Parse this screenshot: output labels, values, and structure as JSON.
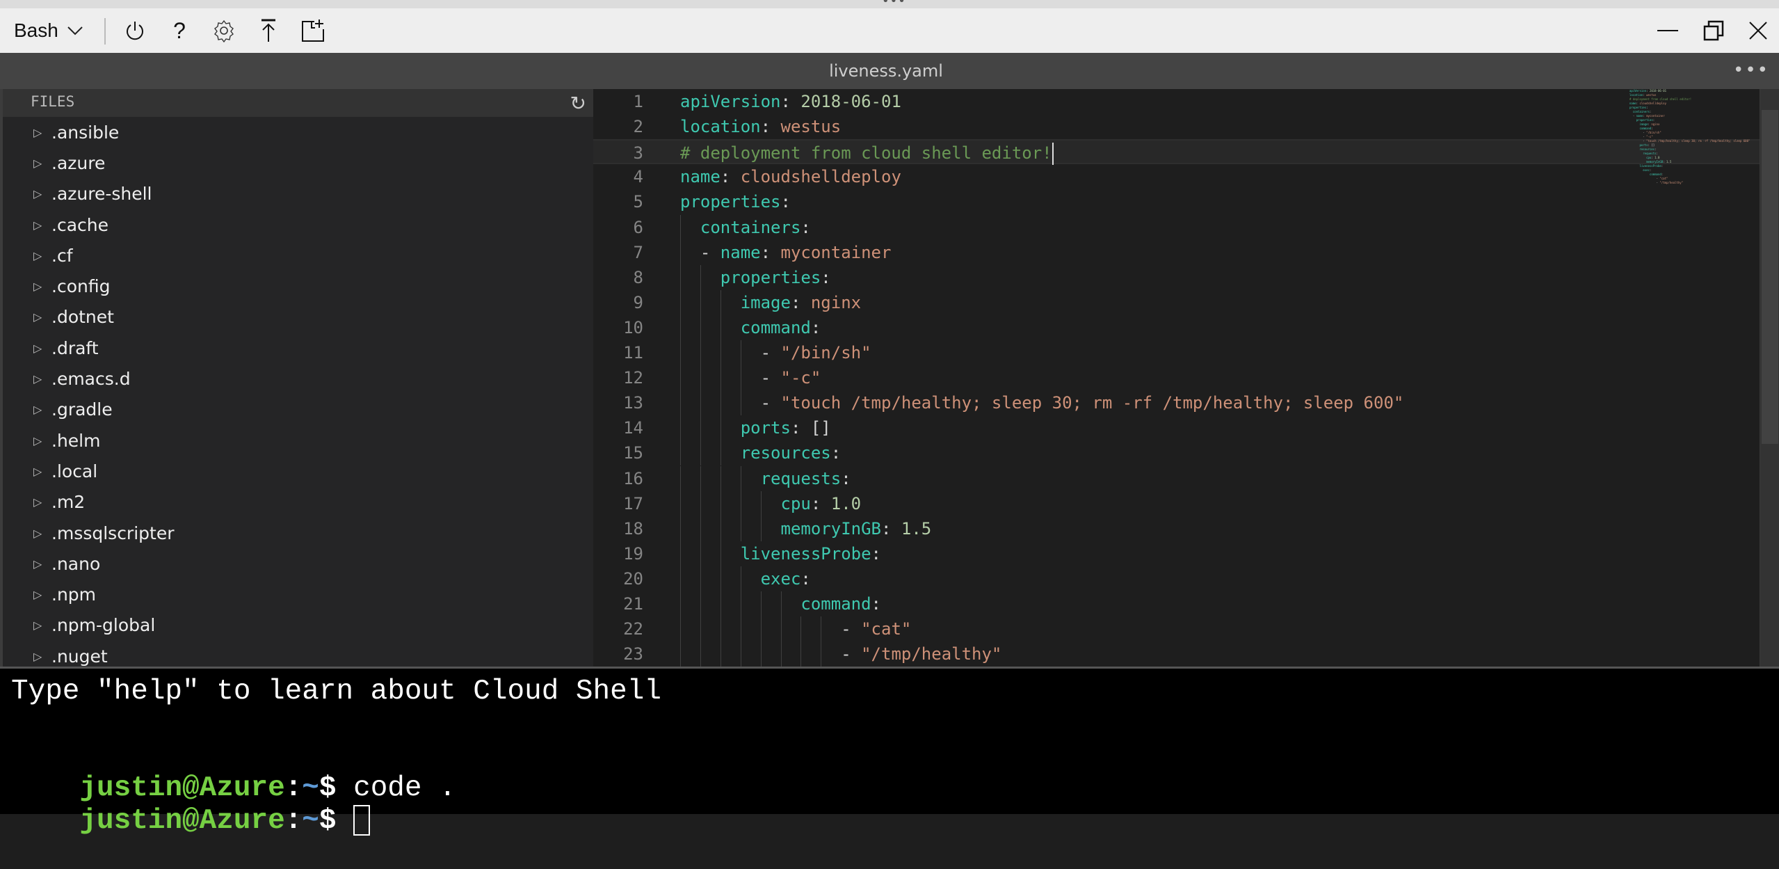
{
  "toolbar": {
    "shell_selector": "Bash",
    "icons": [
      "power-icon",
      "help-icon",
      "gear-icon",
      "upload-icon",
      "new-file-icon"
    ],
    "window_controls": [
      "minimize-icon",
      "restore-icon",
      "close-icon"
    ]
  },
  "editor_tab": {
    "title": "liveness.yaml",
    "more_label": "•••"
  },
  "files": {
    "header": "FILES",
    "items": [
      ".ansible",
      ".azure",
      ".azure-shell",
      ".cache",
      ".cf",
      ".config",
      ".dotnet",
      ".draft",
      ".emacs.d",
      ".gradle",
      ".helm",
      ".local",
      ".m2",
      ".mssqlscripter",
      ".nano",
      ".npm",
      ".npm-global",
      ".nuget"
    ]
  },
  "editor": {
    "cursor_line": 3,
    "lines": [
      [
        [
          "k",
          "apiVersion"
        ],
        [
          "p",
          ": "
        ],
        [
          "n",
          "2018-06-01"
        ]
      ],
      [
        [
          "k",
          "location"
        ],
        [
          "p",
          ": "
        ],
        [
          "s",
          "westus"
        ]
      ],
      [
        [
          "c",
          "# deployment from cloud shell editor!"
        ]
      ],
      [
        [
          "k",
          "name"
        ],
        [
          "p",
          ": "
        ],
        [
          "s",
          "cloudshelldeploy"
        ]
      ],
      [
        [
          "k",
          "properties"
        ],
        [
          "p",
          ":"
        ]
      ],
      [
        [
          "p",
          "  "
        ],
        [
          "k",
          "containers"
        ],
        [
          "p",
          ":"
        ]
      ],
      [
        [
          "p",
          "  - "
        ],
        [
          "k",
          "name"
        ],
        [
          "p",
          ": "
        ],
        [
          "s",
          "mycontainer"
        ]
      ],
      [
        [
          "p",
          "    "
        ],
        [
          "k",
          "properties"
        ],
        [
          "p",
          ":"
        ]
      ],
      [
        [
          "p",
          "      "
        ],
        [
          "k",
          "image"
        ],
        [
          "p",
          ": "
        ],
        [
          "s",
          "nginx"
        ]
      ],
      [
        [
          "p",
          "      "
        ],
        [
          "k",
          "command"
        ],
        [
          "p",
          ":"
        ]
      ],
      [
        [
          "p",
          "        - "
        ],
        [
          "s",
          "\"/bin/sh\""
        ]
      ],
      [
        [
          "p",
          "        - "
        ],
        [
          "s",
          "\"-c\""
        ]
      ],
      [
        [
          "p",
          "        - "
        ],
        [
          "s",
          "\"touch /tmp/healthy; sleep 30; rm -rf /tmp/healthy; sleep 600\""
        ]
      ],
      [
        [
          "p",
          "      "
        ],
        [
          "k",
          "ports"
        ],
        [
          "p",
          ": []"
        ]
      ],
      [
        [
          "p",
          "      "
        ],
        [
          "k",
          "resources"
        ],
        [
          "p",
          ":"
        ]
      ],
      [
        [
          "p",
          "        "
        ],
        [
          "k",
          "requests"
        ],
        [
          "p",
          ":"
        ]
      ],
      [
        [
          "p",
          "          "
        ],
        [
          "k",
          "cpu"
        ],
        [
          "p",
          ": "
        ],
        [
          "n",
          "1.0"
        ]
      ],
      [
        [
          "p",
          "          "
        ],
        [
          "k",
          "memoryInGB"
        ],
        [
          "p",
          ": "
        ],
        [
          "n",
          "1.5"
        ]
      ],
      [
        [
          "p",
          "      "
        ],
        [
          "k",
          "livenessProbe"
        ],
        [
          "p",
          ":"
        ]
      ],
      [
        [
          "p",
          "        "
        ],
        [
          "k",
          "exec"
        ],
        [
          "p",
          ":"
        ]
      ],
      [
        [
          "p",
          "            "
        ],
        [
          "k",
          "command"
        ],
        [
          "p",
          ":"
        ]
      ],
      [
        [
          "p",
          "                - "
        ],
        [
          "s",
          "\"cat\""
        ]
      ],
      [
        [
          "p",
          "                - "
        ],
        [
          "s",
          "\"/tmp/healthy\""
        ]
      ]
    ],
    "colors": {
      "key": "#3fc9b0",
      "string": "#ce9178",
      "number": "#b5cea8",
      "comment": "#6a9955"
    }
  },
  "terminal": {
    "welcome": "Type \"help\" to learn about Cloud Shell",
    "user_host": "justin@Azure",
    "colon": ":",
    "path": "~",
    "dollar": "$",
    "command": " code .",
    "prompt_color": "#76d043",
    "path_color": "#5e9ad6"
  }
}
